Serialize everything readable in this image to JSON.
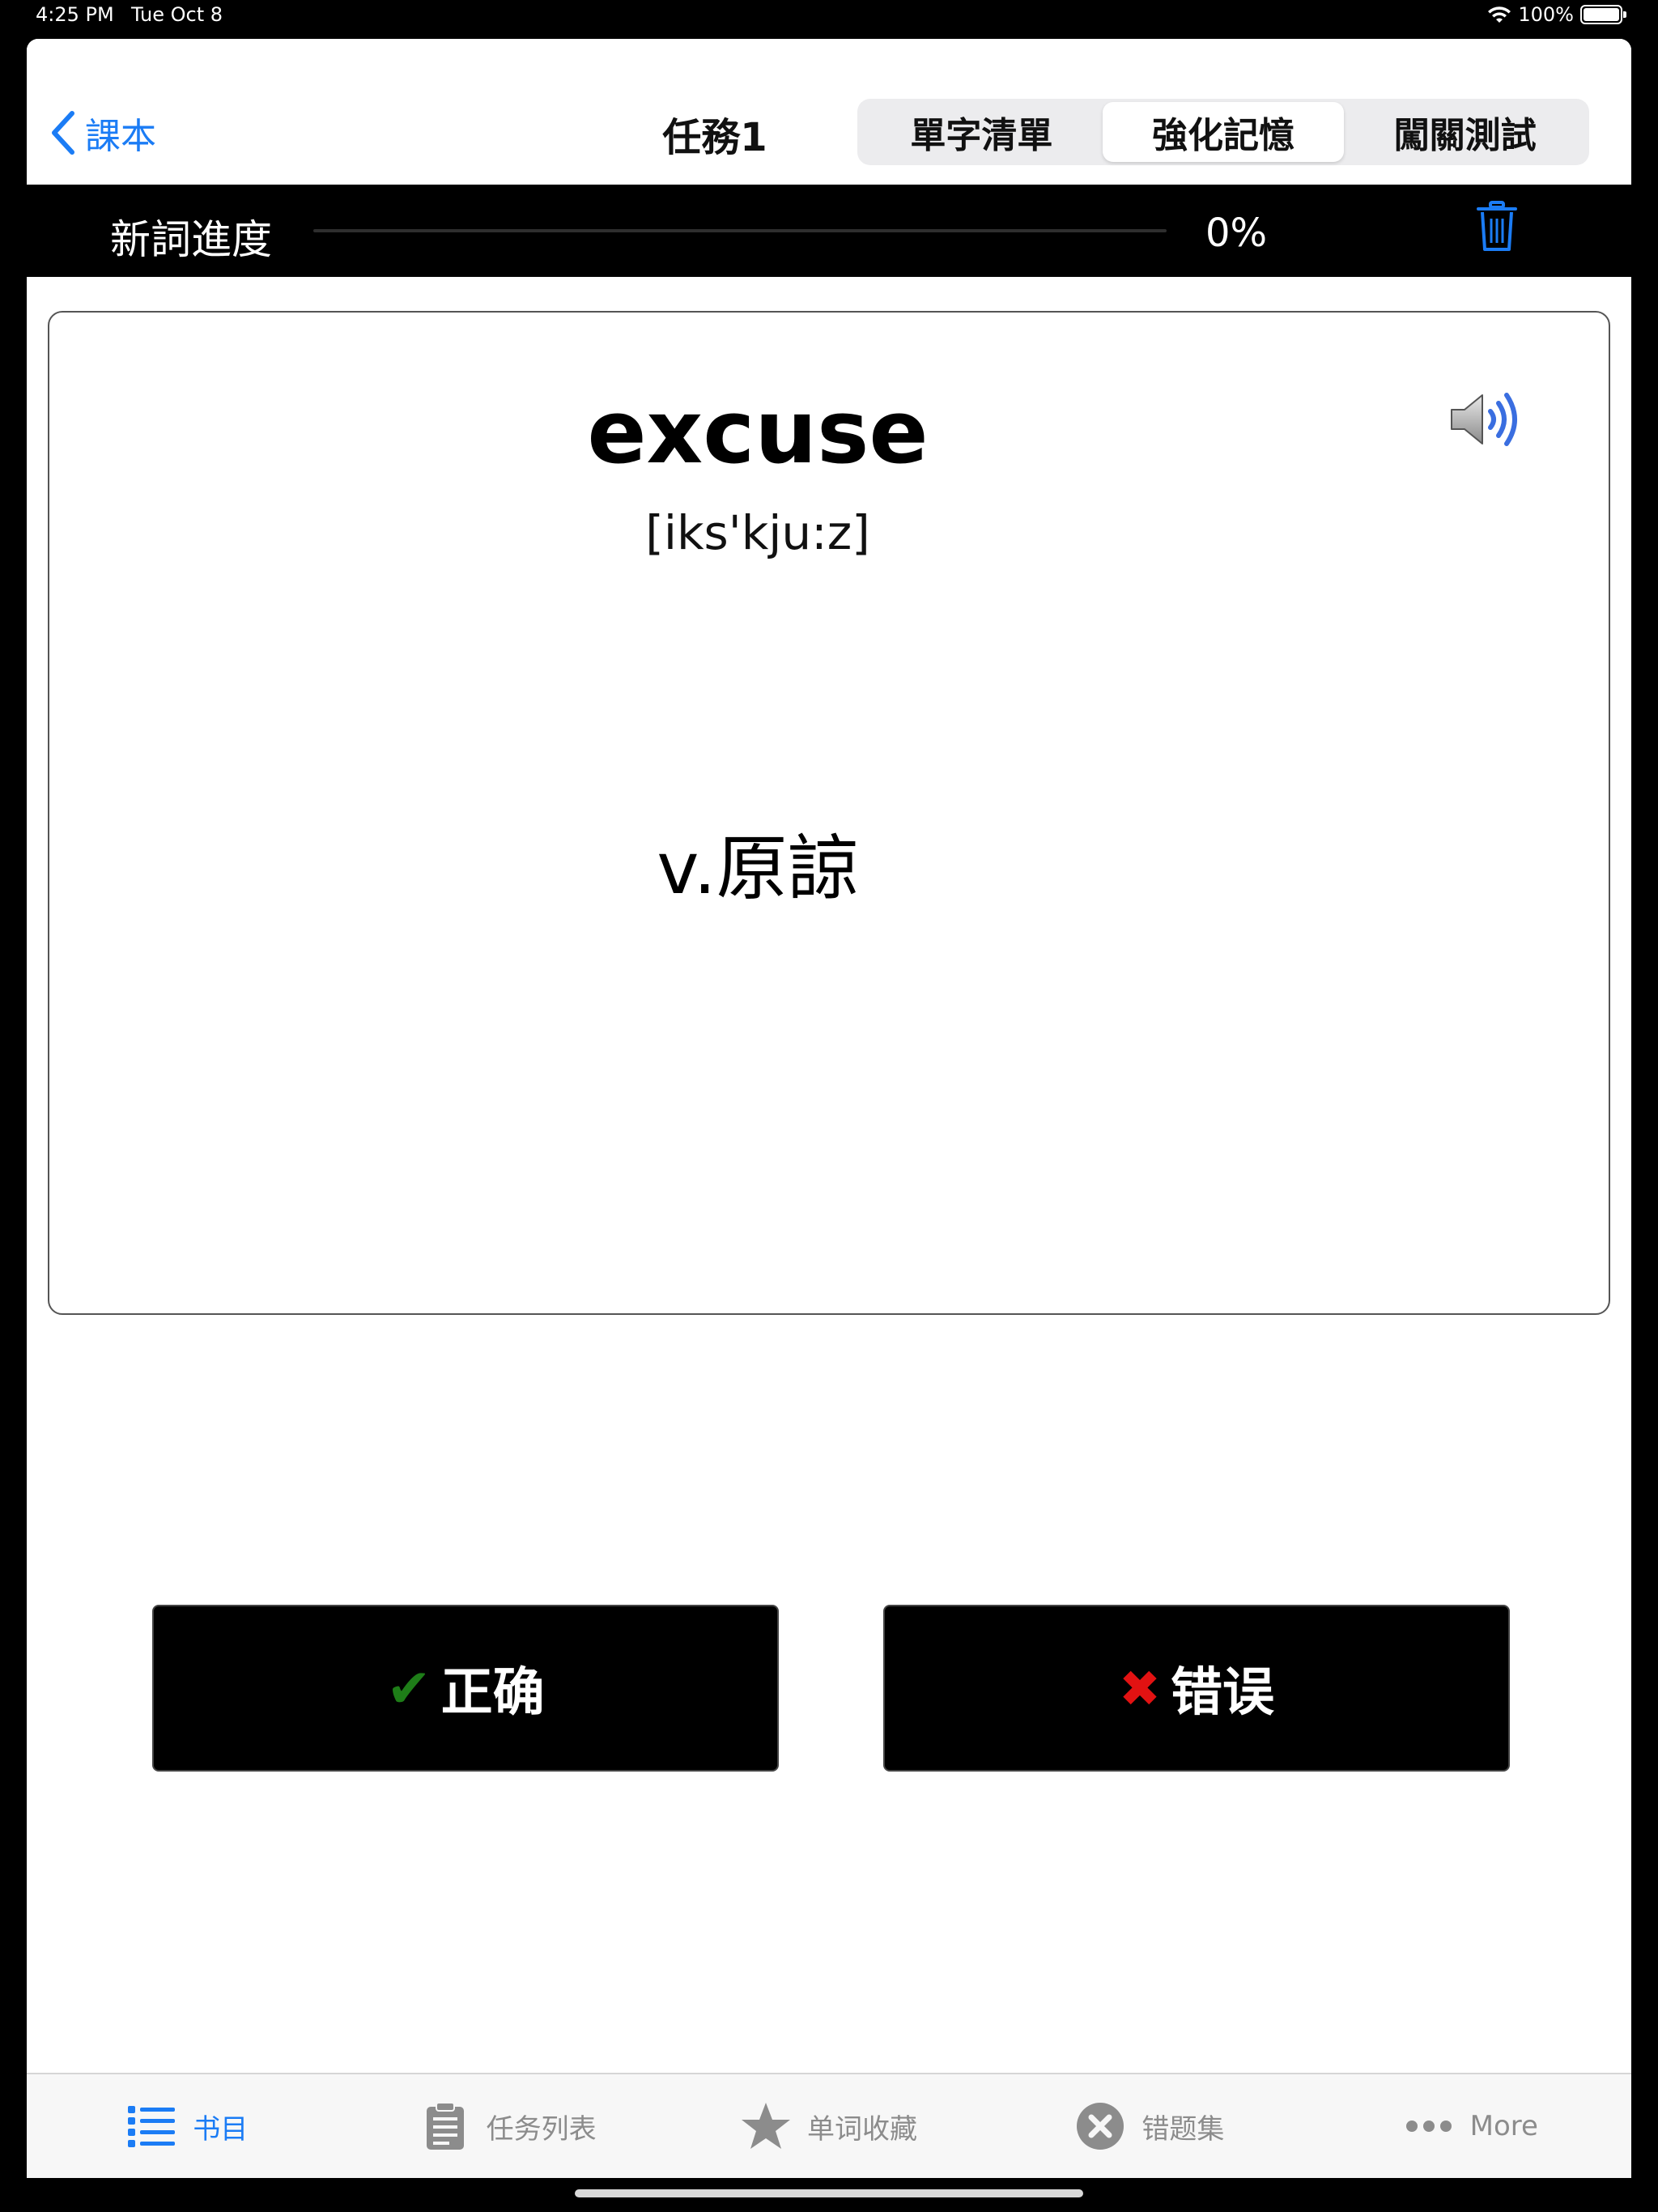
{
  "status_bar": {
    "time": "4:25 PM",
    "date": "Tue Oct 8",
    "battery": "100%"
  },
  "nav": {
    "back_label": "課本",
    "title": "任務1",
    "segments": [
      {
        "label": "單字清單",
        "selected": false
      },
      {
        "label": "強化記憶",
        "selected": true
      },
      {
        "label": "闖關測試",
        "selected": false
      }
    ]
  },
  "progress": {
    "label": "新詞進度",
    "percent_text": "0%",
    "value": 0
  },
  "card": {
    "word": "excuse",
    "phonetic": "[iks'kju:z]",
    "meaning": "v.原諒",
    "speaker_icon": "speaker-icon"
  },
  "buttons": {
    "correct_label": "正确",
    "wrong_label": "错误",
    "correct_icon": "✔",
    "wrong_icon": "✖"
  },
  "tabs": [
    {
      "label": "书目",
      "icon": "list-icon",
      "active": true
    },
    {
      "label": "任务列表",
      "icon": "clipboard-icon",
      "active": false
    },
    {
      "label": "单词收藏",
      "icon": "star-icon",
      "active": false
    },
    {
      "label": "错题集",
      "icon": "x-circle-icon",
      "active": false
    },
    {
      "label": "More",
      "icon": "more-icon",
      "active": false
    }
  ],
  "colors": {
    "accent": "#1b7cf5",
    "correct": "#1e7d18",
    "wrong": "#e21212",
    "tab_inactive": "#8c8c8c"
  }
}
